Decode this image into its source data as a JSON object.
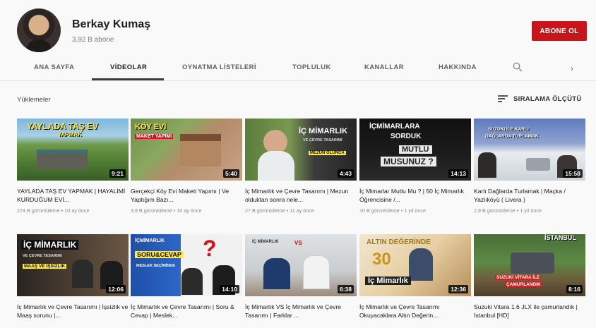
{
  "channel": {
    "name": "Berkay Kumaş",
    "subscribers": "3,92 B abone",
    "subscribe_label": "ABONE OL"
  },
  "tabs": [
    "ANA SAYFA",
    "VİDEOLAR",
    "OYNATMA LİSTELERİ",
    "TOPLULUK",
    "KANALLAR",
    "HAKKINDA"
  ],
  "active_tab": "VİDEOLAR",
  "section": {
    "title": "Yüklemeler",
    "sort_label": "SIRALAMA ÖLÇÜTÜ"
  },
  "videos": [
    {
      "title": "YAYLADA TAŞ EV YAPMAK | HAYALİMİ KURDUĞUM EVİ...",
      "meta": "274 B görüntüleme • 10 ay önce",
      "duration": "9:21",
      "overlay": [
        "YAYLADA TAŞ EV",
        "YAPMAK"
      ]
    },
    {
      "title": "Gerçekçi Köy Evi Maketi Yapımı | Ve Yaptığım Bazı...",
      "meta": "3,9 B görüntüleme • 10 ay önce",
      "duration": "5:40",
      "overlay": [
        "KÖY EVİ",
        "MAKET YAPIMI"
      ]
    },
    {
      "title": "İç Mimarlık ve Çevre Tasarımı | Mezun olduktan sonra nele...",
      "meta": "27 B görüntüleme • 11 ay önce",
      "duration": "4:43",
      "overlay": [
        "İÇ MİMARLIK",
        "VE ÇEVRE TASARIMI",
        "MEZUN OLUNCA"
      ]
    },
    {
      "title": "İç Mimarlar Mutlu Mu ? | 50 İç Mimarlık Öğrencisine /...",
      "meta": "10 B görüntüleme • 1 yıl önce",
      "duration": "14:13",
      "overlay": [
        "İÇMİMARLARA",
        "SORDUK",
        "MUTLU",
        "MUSUNUZ ?"
      ]
    },
    {
      "title": "Karlı Dağlarda Turlamak | Maçka / Yazlıköyü ( Livera )",
      "meta": "2,9 B görüntüleme • 1 yıl önce",
      "duration": "15:58",
      "overlay": [
        "SUZUKI İLE KARLI",
        "DAĞLARDA TURLAMAK"
      ]
    },
    {
      "title": "İç Mimarlık ve Çevre Tasarımı | İşsizlik ve Maaş sorunu |...",
      "meta": "",
      "duration": "12:06",
      "overlay": [
        "İÇ MİMARLIK",
        "VE ÇEVRE TASARIMI",
        "MAAŞ VE İŞSİZLİK"
      ]
    },
    {
      "title": "İç Mimarlık ve Çevre Tasarımı | Soru & Cevap | Meslek...",
      "meta": "",
      "duration": "14:10",
      "overlay": [
        "İÇMİMARLIK",
        "SORU&CEVAP",
        "MESLEK SEÇİMİNDE"
      ]
    },
    {
      "title": "İç Mimarlık VS İç Mimarlık ve Çevre Tasarımı | Farklar ...",
      "meta": "",
      "duration": "6:38",
      "overlay": [
        "İÇ MİMARLIK",
        "VS"
      ]
    },
    {
      "title": "İç Mimarlık ve Çevre Tasarımı Okuyacaklara Altın Değerin...",
      "meta": "",
      "duration": "12:36",
      "overlay": [
        "ALTIN DEĞERİNDE",
        "30",
        "İç Mimarlık"
      ]
    },
    {
      "title": "Suzuki Vitara 1.6 JLX ile çamurlandık | İstanbul [HD]",
      "meta": "",
      "duration": "8:16",
      "overlay": [
        "İSTANBUL",
        "SUZUKİ VİTARA İLE",
        "ÇAMURLANDIK"
      ]
    }
  ]
}
